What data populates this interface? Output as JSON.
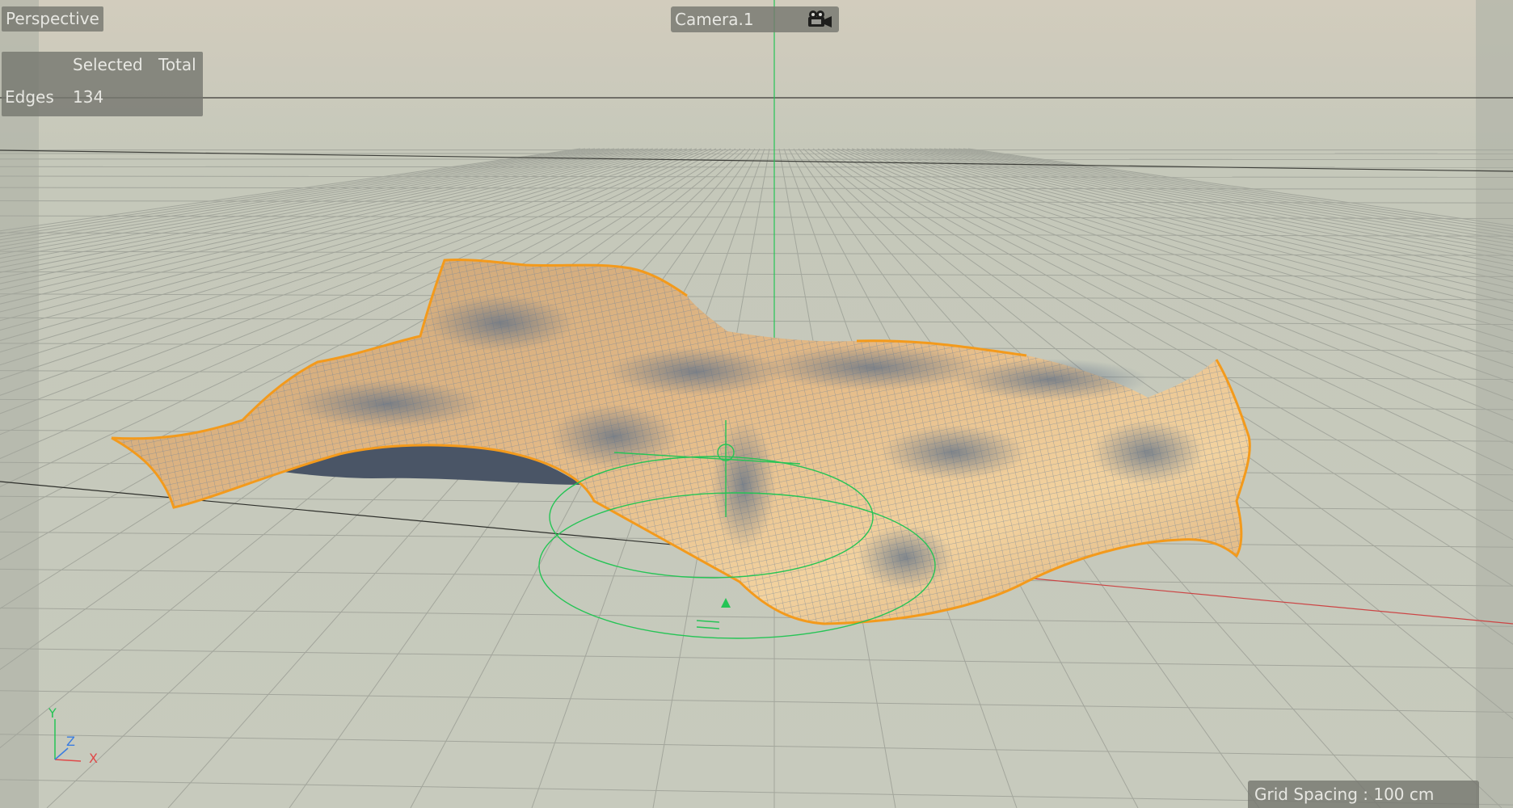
{
  "viewport": {
    "view_name": "Perspective",
    "camera": {
      "name": "Camera.1",
      "icon": "camera-icon"
    },
    "stats": {
      "col_selected": "Selected",
      "col_total": "Total",
      "rows": [
        {
          "label": "Edges",
          "selected": "134",
          "total": ""
        }
      ]
    },
    "grid_spacing": "Grid Spacing : 100 cm",
    "axis_labels": {
      "y": "Y",
      "z": "Z",
      "x": "X"
    }
  },
  "colors": {
    "background": "#c6c9bc",
    "grid_line": "#a7aaa0",
    "horizon_line": "#3a3a36",
    "cloth_fill": "#e9bf8a",
    "cloth_wire": "#7e8ea0",
    "selection_outline": "#f39a1c",
    "gizmo": "#25c455",
    "axis_x": "#e04848",
    "axis_y": "#25c455",
    "axis_z": "#3b7de0",
    "hud_panel": "#767870",
    "hud_text": "#e7e7e2"
  }
}
